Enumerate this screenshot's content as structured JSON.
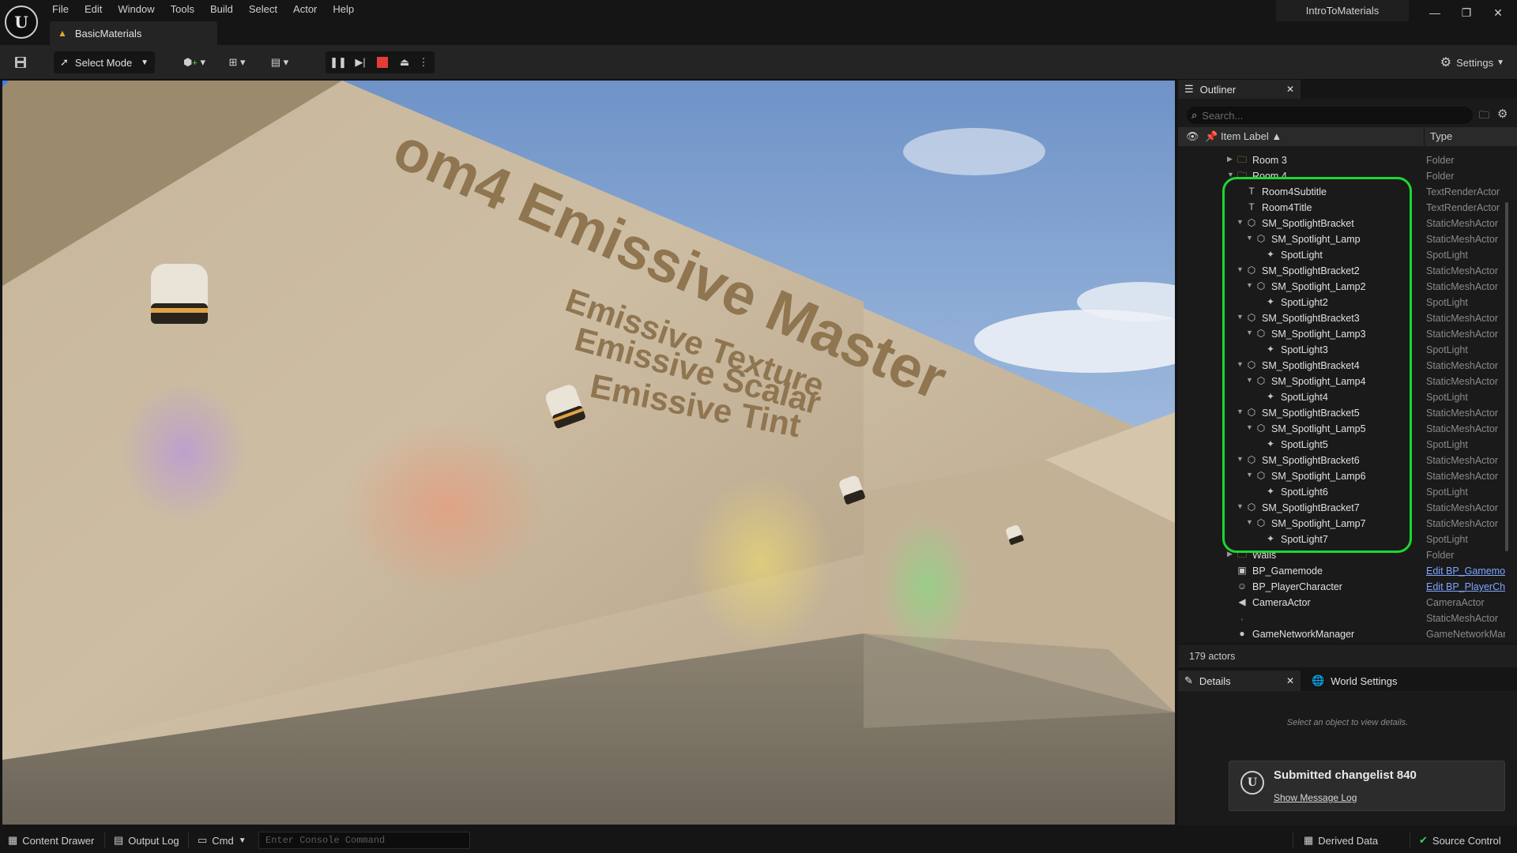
{
  "app": {
    "project_name": "IntroToMaterials",
    "level_tab": "BasicMaterials",
    "menu": [
      "File",
      "Edit",
      "Window",
      "Tools",
      "Build",
      "Select",
      "Actor",
      "Help"
    ]
  },
  "toolbar": {
    "select_mode": "Select Mode",
    "settings": "Settings"
  },
  "viewport": {
    "wall_title": "om4 Emissive Master",
    "wall_lines": [
      "Emissive Texture",
      "Emissive Scalar",
      "Emissive Tint"
    ]
  },
  "outliner": {
    "tab_label": "Outliner",
    "search_placeholder": "Search...",
    "col_label": "Item Label",
    "col_type": "Type",
    "rows": [
      {
        "label": "Room 3",
        "type": "Folder"
      },
      {
        "label": "Room 4",
        "type": "Folder"
      },
      {
        "label": "Room4Subtitle",
        "type": "TextRenderActor"
      },
      {
        "label": "Room4Title",
        "type": "TextRenderActor"
      },
      {
        "label": "SM_SpotlightBracket",
        "type": "StaticMeshActor"
      },
      {
        "label": "SM_Spotlight_Lamp",
        "type": "StaticMeshActor"
      },
      {
        "label": "SpotLight",
        "type": "SpotLight"
      },
      {
        "label": "SM_SpotlightBracket2",
        "type": "StaticMeshActor"
      },
      {
        "label": "SM_Spotlight_Lamp2",
        "type": "StaticMeshActor"
      },
      {
        "label": "SpotLight2",
        "type": "SpotLight"
      },
      {
        "label": "SM_SpotlightBracket3",
        "type": "StaticMeshActor"
      },
      {
        "label": "SM_Spotlight_Lamp3",
        "type": "StaticMeshActor"
      },
      {
        "label": "SpotLight3",
        "type": "SpotLight"
      },
      {
        "label": "SM_SpotlightBracket4",
        "type": "StaticMeshActor"
      },
      {
        "label": "SM_Spotlight_Lamp4",
        "type": "StaticMeshActor"
      },
      {
        "label": "SpotLight4",
        "type": "SpotLight"
      },
      {
        "label": "SM_SpotlightBracket5",
        "type": "StaticMeshActor"
      },
      {
        "label": "SM_Spotlight_Lamp5",
        "type": "StaticMeshActor"
      },
      {
        "label": "SpotLight5",
        "type": "SpotLight"
      },
      {
        "label": "SM_SpotlightBracket6",
        "type": "StaticMeshActor"
      },
      {
        "label": "SM_Spotlight_Lamp6",
        "type": "StaticMeshActor"
      },
      {
        "label": "SpotLight6",
        "type": "SpotLight"
      },
      {
        "label": "SM_SpotlightBracket7",
        "type": "StaticMeshActor"
      },
      {
        "label": "SM_Spotlight_Lamp7",
        "type": "StaticMeshActor"
      },
      {
        "label": "SpotLight7",
        "type": "SpotLight"
      },
      {
        "label": "Walls",
        "type": "Folder"
      },
      {
        "label": "BP_Gamemode",
        "type": "Edit BP_Gamemode"
      },
      {
        "label": "BP_PlayerCharacter",
        "type": "Edit BP_PlayerCharacter"
      },
      {
        "label": "CameraActor",
        "type": "CameraActor"
      },
      {
        "label": "",
        "type": "StaticMeshActor"
      },
      {
        "label": "GameNetworkManager",
        "type": "GameNetworkManager"
      }
    ],
    "actor_count": "179 actors"
  },
  "details": {
    "tab_details": "Details",
    "tab_world": "World Settings",
    "empty_text": "Select an object to view details."
  },
  "notification": {
    "title": "Submitted changelist 840",
    "link": "Show Message Log"
  },
  "statusbar": {
    "content_drawer": "Content Drawer",
    "output_log": "Output Log",
    "cmd": "Cmd",
    "console_placeholder": "Enter Console Command",
    "derived_data": "Derived Data",
    "source_control": "Source Control"
  },
  "colors": {
    "highlight": "#1dd730",
    "stop_button": "#e53b3b",
    "link": "#7da6ff"
  }
}
